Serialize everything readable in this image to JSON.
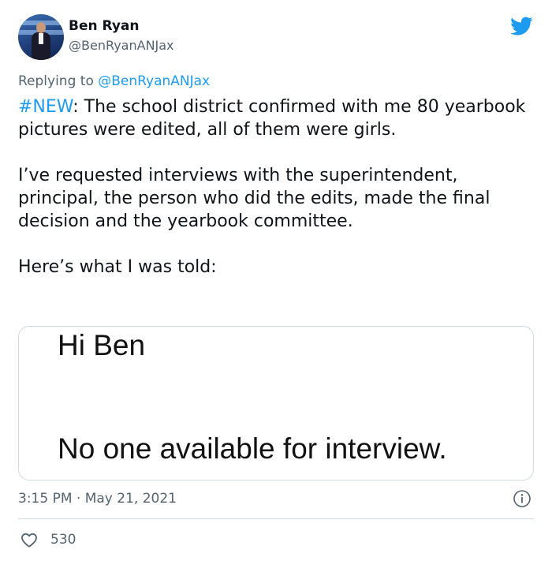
{
  "author": {
    "display_name": "Ben Ryan",
    "handle": "@BenRyanANJax"
  },
  "reply": {
    "prefix": "Replying to ",
    "mention": "@BenRyanANJax"
  },
  "tweet": {
    "hashtag": "#NEW",
    "line1_rest": ": The school district confirmed with me 80 yearbook pictures were edited, all of them were girls.",
    "paragraph2": "I’ve requested interviews with the superintendent, principal, the person who did the edits, made the final decision and the yearbook committee.",
    "paragraph3": "Here’s what I was told:"
  },
  "media": {
    "line1": "Hi Ben",
    "line2": "No one available for interview."
  },
  "meta": {
    "time": "3:15 PM",
    "separator": " · ",
    "date": "May 21, 2021"
  },
  "engagement": {
    "likes": "530"
  },
  "icons": {
    "brand": "twitter-bird-icon",
    "info": "info-icon",
    "like": "heart-icon"
  },
  "colors": {
    "accent": "#1d9bf0",
    "secondary_text": "#536471",
    "border": "#cfd9de",
    "text": "#0f1419"
  }
}
